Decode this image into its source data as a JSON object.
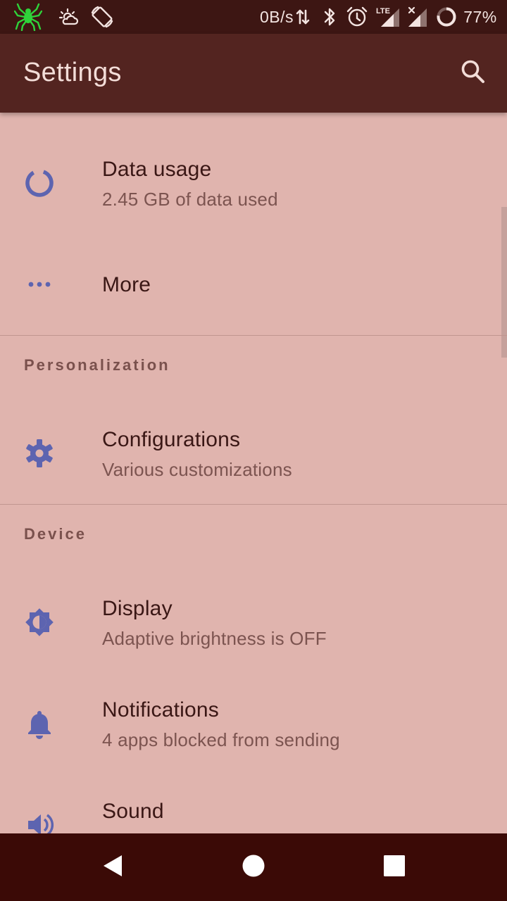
{
  "status_bar": {
    "icons": [
      "spider-icon",
      "weather-icon",
      "screen-rotation-icon",
      "data-transfer-icon",
      "bluetooth-icon",
      "alarm-icon",
      "lte-signal-icon",
      "no-signal-icon",
      "battery-ring-icon"
    ],
    "network_speed": "0B/s",
    "network_type": "LTE",
    "battery_percent": "77%",
    "battery_level": 0.77
  },
  "app_bar": {
    "title": "Settings",
    "search_icon": "search-icon"
  },
  "settings": {
    "items": [
      {
        "icon": "data-usage-icon",
        "title": "Data usage",
        "subtitle": "2.45 GB of data used"
      },
      {
        "icon": "more-dots-icon",
        "title": "More"
      }
    ],
    "sections": [
      {
        "header": "Personalization",
        "items": [
          {
            "icon": "gear-icon",
            "title": "Configurations",
            "subtitle": "Various customizations"
          }
        ]
      },
      {
        "header": "Device",
        "items": [
          {
            "icon": "brightness-icon",
            "title": "Display",
            "subtitle": "Adaptive brightness is OFF"
          },
          {
            "icon": "bell-icon",
            "title": "Notifications",
            "subtitle": "4 apps blocked from sending"
          },
          {
            "icon": "speaker-icon",
            "title": "Sound"
          }
        ]
      }
    ]
  },
  "nav_bar": {
    "buttons": [
      "back-icon",
      "home-icon",
      "recents-icon"
    ]
  },
  "colors": {
    "status_bar": "#3d1613",
    "app_bar": "#532420",
    "background": "#e0b4ae",
    "icon_accent": "#5d64b0",
    "nav_bar": "#3b0a06"
  }
}
